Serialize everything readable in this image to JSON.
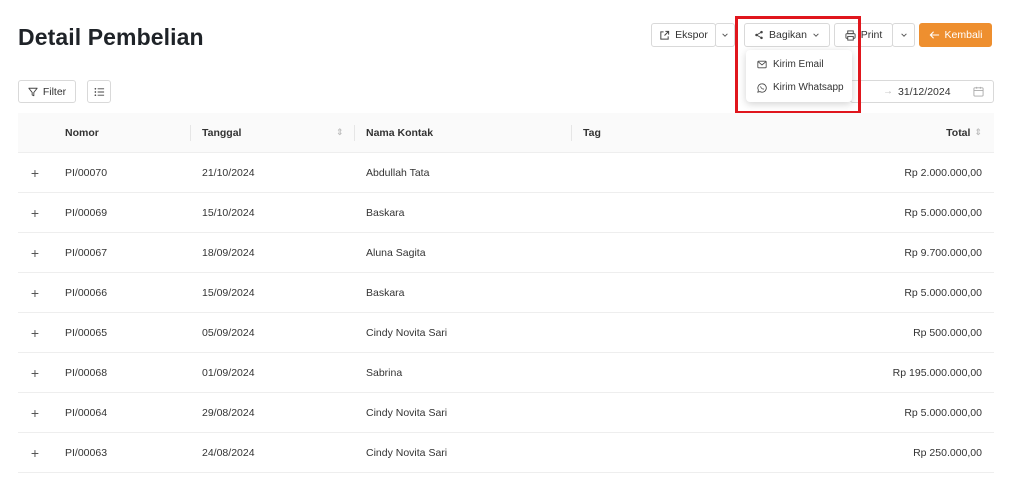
{
  "header": {
    "title": "Detail Pembelian",
    "export_label": "Ekspor",
    "share_label": "Bagikan",
    "print_label": "Print",
    "back_label": "Kembali"
  },
  "share_menu": {
    "items": [
      {
        "label": "Kirim Email",
        "icon": "mail-icon"
      },
      {
        "label": "Kirim Whatsapp",
        "icon": "whatsapp-icon"
      }
    ]
  },
  "toolbar": {
    "filter_label": "Filter",
    "date_end": "31/12/2024"
  },
  "table": {
    "headers": {
      "nomor": "Nomor",
      "tanggal": "Tanggal",
      "nama_kontak": "Nama Kontak",
      "tag": "Tag",
      "total": "Total"
    },
    "rows": [
      {
        "expand": "+",
        "nomor": "PI/00070",
        "tanggal": "21/10/2024",
        "kontak": "Abdullah Tata",
        "tag": "",
        "total": "Rp 2.000.000,00"
      },
      {
        "expand": "+",
        "nomor": "PI/00069",
        "tanggal": "15/10/2024",
        "kontak": "Baskara",
        "tag": "",
        "total": "Rp 5.000.000,00"
      },
      {
        "expand": "+",
        "nomor": "PI/00067",
        "tanggal": "18/09/2024",
        "kontak": "Aluna Sagita",
        "tag": "",
        "total": "Rp 9.700.000,00"
      },
      {
        "expand": "+",
        "nomor": "PI/00066",
        "tanggal": "15/09/2024",
        "kontak": "Baskara",
        "tag": "",
        "total": "Rp 5.000.000,00"
      },
      {
        "expand": "+",
        "nomor": "PI/00065",
        "tanggal": "05/09/2024",
        "kontak": "Cindy Novita Sari",
        "tag": "",
        "total": "Rp 500.000,00"
      },
      {
        "expand": "+",
        "nomor": "PI/00068",
        "tanggal": "01/09/2024",
        "kontak": "Sabrina",
        "tag": "",
        "total": "Rp 195.000.000,00"
      },
      {
        "expand": "+",
        "nomor": "PI/00064",
        "tanggal": "29/08/2024",
        "kontak": "Cindy Novita Sari",
        "tag": "",
        "total": "Rp 5.000.000,00"
      },
      {
        "expand": "+",
        "nomor": "PI/00063",
        "tanggal": "24/08/2024",
        "kontak": "Cindy Novita Sari",
        "tag": "",
        "total": "Rp 250.000,00"
      }
    ]
  },
  "colors": {
    "accent": "#ee8f2f",
    "highlight": "#e0161d"
  }
}
